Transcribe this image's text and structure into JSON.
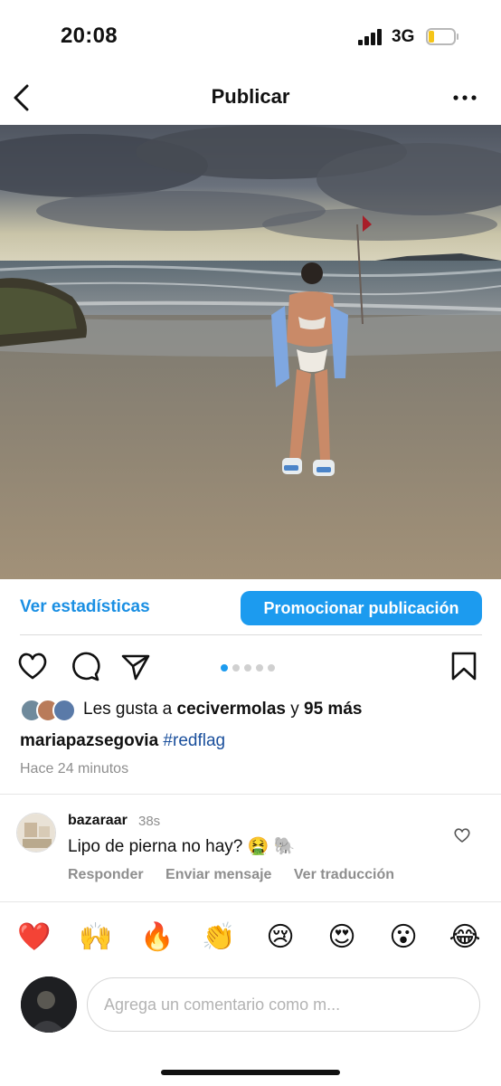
{
  "status_bar": {
    "time": "20:08",
    "network": "3G"
  },
  "nav": {
    "title": "Publicar"
  },
  "stats": {
    "link_label": "Ver estadísticas",
    "promote_label": "Promocionar publicación"
  },
  "carousel": {
    "total": 5,
    "active": 1
  },
  "likes": {
    "prefix": "Les gusta a",
    "user": "cecivermolas",
    "joiner": "y",
    "count_label": "95 más"
  },
  "caption": {
    "username": "mariapazsegovia",
    "hashtag": "#redflag"
  },
  "post_time": "Hace 24 minutos",
  "comment": {
    "username": "bazaraar",
    "age": "38s",
    "text": "Lipo de pierna no hay? 🤮 🐘",
    "reply_label": "Responder",
    "message_label": "Enviar mensaje",
    "translate_label": "Ver traducción"
  },
  "quick_reactions": [
    "❤️",
    "🙌",
    "🔥",
    "👏",
    "😢",
    "😍",
    "😮",
    "😂"
  ],
  "composer": {
    "placeholder": "Agrega un comentario como m..."
  },
  "colors": {
    "accent": "#1c9bef",
    "link": "#1a8fe3",
    "hashtag": "#1a4f9c",
    "muted": "#8e8e8e"
  },
  "icons": [
    "back-chevron-icon",
    "more-options-icon",
    "heart-icon",
    "comment-icon",
    "share-icon",
    "bookmark-icon"
  ]
}
